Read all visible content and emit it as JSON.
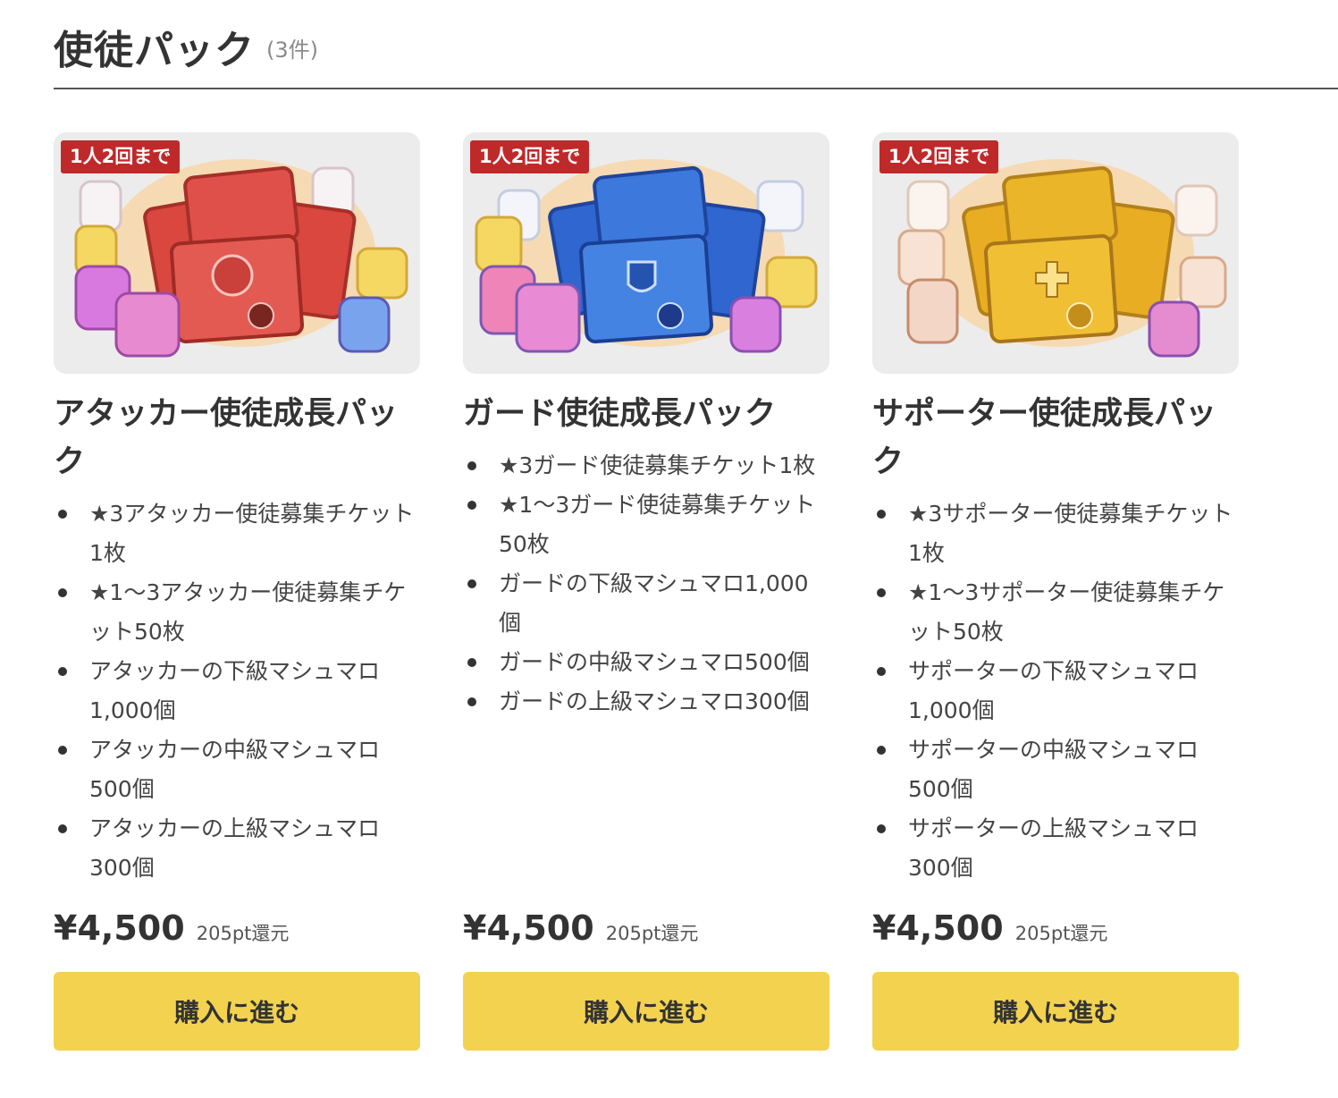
{
  "header": {
    "title": "使徒パック",
    "count": "(3件)"
  },
  "colors": {
    "badge": "#c0292a",
    "button": "#f3d24f",
    "attacker": "#e0504a",
    "guard": "#3d78dc",
    "supporter": "#eab528"
  },
  "packs": [
    {
      "badge": "1人2回まで",
      "image_icon": "attacker-pack-image",
      "title": "アタッカー使徒成長パック",
      "items": [
        "★3アタッカー使徒募集チケット1枚",
        "★1〜3アタッカー使徒募集チケット50枚",
        "アタッカーの下級マシュマロ1,000個",
        "アタッカーの中級マシュマロ500個",
        "アタッカーの上級マシュマロ300個"
      ],
      "price": "¥4,500",
      "points": "205pt還元",
      "button": "購入に進む"
    },
    {
      "badge": "1人2回まで",
      "image_icon": "guard-pack-image",
      "title": "ガード使徒成長パック",
      "items": [
        "★3ガード使徒募集チケット1枚",
        "★1〜3ガード使徒募集チケット50枚",
        "ガードの下級マシュマロ1,000個",
        "ガードの中級マシュマロ500個",
        "ガードの上級マシュマロ300個"
      ],
      "price": "¥4,500",
      "points": "205pt還元",
      "button": "購入に進む"
    },
    {
      "badge": "1人2回まで",
      "image_icon": "supporter-pack-image",
      "title": "サポーター使徒成長パック",
      "items": [
        "★3サポーター使徒募集チケット1枚",
        "★1〜3サポーター使徒募集チケット50枚",
        "サポーターの下級マシュマロ1,000個",
        "サポーターの中級マシュマロ500個",
        "サポーターの上級マシュマロ300個"
      ],
      "price": "¥4,500",
      "points": "205pt還元",
      "button": "購入に進む"
    }
  ]
}
